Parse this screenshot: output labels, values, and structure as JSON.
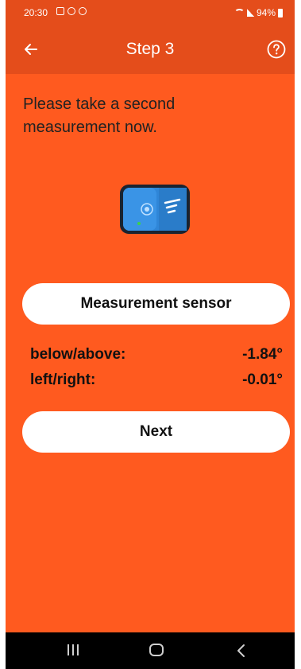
{
  "status_bar": {
    "time": "20:30",
    "battery": "94%"
  },
  "app_bar": {
    "title": "Step 3",
    "back_icon": "arrow-back-icon",
    "help_icon": "help-circle-icon"
  },
  "content": {
    "instruction": "Please take a second measurement now.",
    "sensor_icon": "wit-sensor-device-icon",
    "sensor_button_label": "Measurement sensor",
    "readings": [
      {
        "label": "below/above:",
        "value": "-1.84°"
      },
      {
        "label": "left/right:",
        "value": "-0.01°"
      }
    ],
    "next_button_label": "Next"
  },
  "nav_bar": {
    "recents_icon": "recents-icon",
    "home_icon": "home-icon",
    "back_icon": "nav-back-icon"
  },
  "colors": {
    "background": "#ff5a1f",
    "app_bar": "#e44d1b",
    "button": "#ffffff",
    "nav_bar": "#000000"
  }
}
